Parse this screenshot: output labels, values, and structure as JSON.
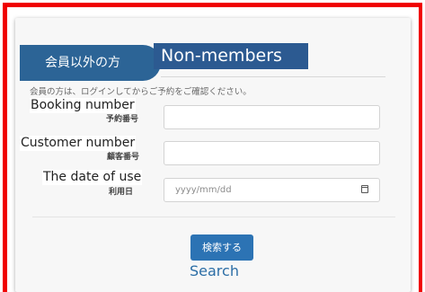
{
  "tab": {
    "label": "会員以外の方",
    "overlay_label": "Non-members"
  },
  "notice": "会員の方は、ログインしてからご予約をご確認ください。",
  "fields": [
    {
      "label_en": "Booking number",
      "label_jp": "予約番号",
      "value": "",
      "placeholder": ""
    },
    {
      "label_en": "Customer number",
      "label_jp": "顧客番号",
      "value": "",
      "placeholder": ""
    },
    {
      "label_en": "The date of use",
      "label_jp": "利用日",
      "value": "",
      "placeholder": "yyyy/mm/dd",
      "icon": "calendar-icon"
    }
  ],
  "search": {
    "button_label": "検索する",
    "caption": "Search"
  },
  "colors": {
    "tab_blue": "#2c6496",
    "overlay_blue": "#2c5a91",
    "button_blue": "#2c73b4",
    "highlight_border": "#f00000"
  }
}
